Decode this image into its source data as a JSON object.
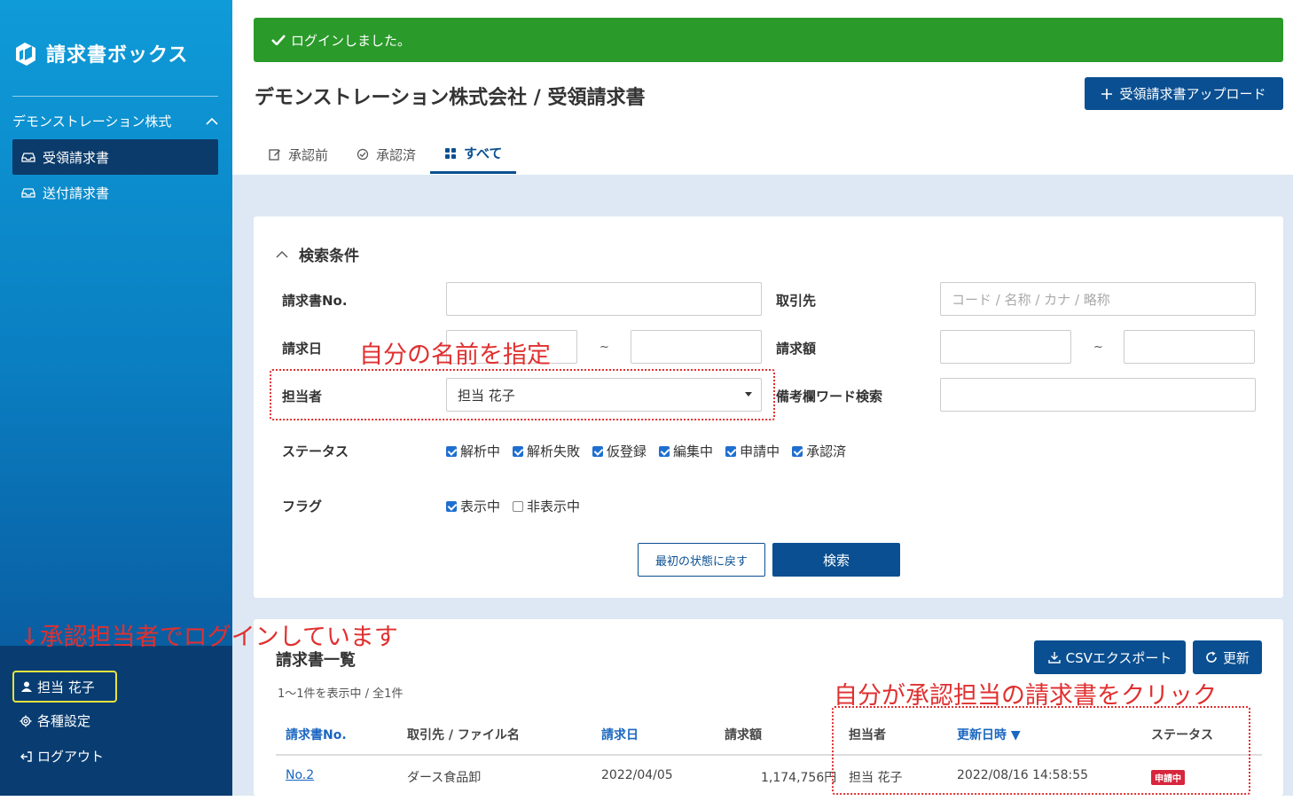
{
  "sidebar": {
    "logo_text": "請求書ボックス",
    "company": "デモンストレーション株式",
    "items": [
      {
        "label": "受領請求書",
        "icon": "inbox-icon",
        "active": true
      },
      {
        "label": "送付請求書",
        "icon": "inbox-icon",
        "active": false
      }
    ],
    "user": "担当 花子",
    "settings": "各種設定",
    "logout": "ログアウト"
  },
  "flash": "ログインしました。",
  "header": {
    "title": "デモンストレーション株式会社 / 受領請求書",
    "upload_label": "受領請求書アップロード"
  },
  "tabs": [
    {
      "label": "承認前",
      "icon": "edit-icon"
    },
    {
      "label": "承認済",
      "icon": "check-circle-icon"
    },
    {
      "label": "すべて",
      "icon": "grid-icon",
      "active": true
    }
  ],
  "search": {
    "title": "検索条件",
    "invoice_no_label": "請求書No.",
    "client_label": "取引先",
    "client_placeholder": "コード / 名称 / カナ / 略称",
    "date_label": "請求日",
    "amount_label": "請求額",
    "tilde": "~",
    "assignee_label": "担当者",
    "assignee_value": "担当 花子",
    "memo_label": "備考欄ワード検索",
    "status_label": "ステータス",
    "statuses": [
      "解析中",
      "解析失敗",
      "仮登録",
      "編集中",
      "申請中",
      "承認済"
    ],
    "flag_label": "フラグ",
    "flags": [
      {
        "label": "表示中",
        "checked": true
      },
      {
        "label": "非表示中",
        "checked": false
      }
    ],
    "reset_label": "最初の状態に戻す",
    "search_label": "検索"
  },
  "list": {
    "title": "請求書一覧",
    "count": "1〜1件を表示中 / 全1件",
    "csv_label": "CSVエクスポート",
    "refresh_label": "更新",
    "columns": [
      "請求書No.",
      "取引先 / ファイル名",
      "請求日",
      "請求額",
      "担当者",
      "更新日時 ▼",
      "ステータス"
    ],
    "rows": [
      {
        "no": "No.2",
        "client": "ダース食品卸",
        "date": "2022/04/05",
        "amount": "1,174,756円",
        "assignee": "担当 花子",
        "updated": "2022/08/16 14:58:55",
        "status": "申請中"
      }
    ]
  },
  "annotations": {
    "name_hint": "自分の名前を指定",
    "login_hint": "↓承認担当者でログインしています",
    "click_hint": "自分が承認担当の請求書をクリック"
  }
}
